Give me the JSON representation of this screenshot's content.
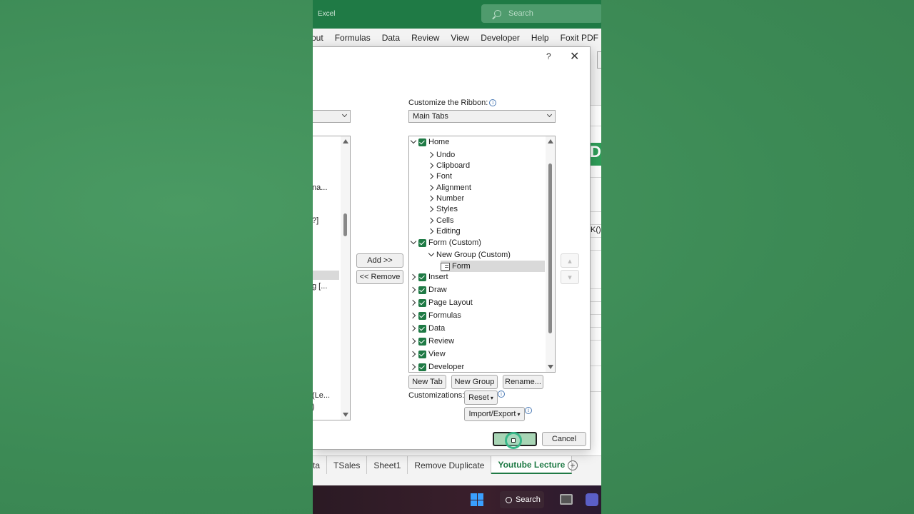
{
  "window": {
    "app_title": "Excel",
    "search_placeholder": "Search"
  },
  "ribbon": {
    "tabs": [
      "out",
      "Formulas",
      "Data",
      "Review",
      "View",
      "Developer",
      "Help",
      "Foxit PDF"
    ]
  },
  "sheet": {
    "green_cell_text": "D",
    "cell_text": "K()"
  },
  "dialog": {
    "help_label": "?",
    "close_label": "✕",
    "left_list_items": [
      "na...",
      "?]",
      "g [...",
      "(Le...",
      ")"
    ],
    "add_button": "Add >>",
    "remove_button": "<< Remove",
    "customize_label": "Customize the Ribbon:",
    "ribbon_combo_value": "Main Tabs",
    "tree": [
      {
        "label": "Home",
        "level": 0,
        "expanded": true,
        "checked": true
      },
      {
        "label": "Undo",
        "level": 1,
        "expanded": false
      },
      {
        "label": "Clipboard",
        "level": 1,
        "expanded": false
      },
      {
        "label": "Font",
        "level": 1,
        "expanded": false
      },
      {
        "label": "Alignment",
        "level": 1,
        "expanded": false
      },
      {
        "label": "Number",
        "level": 1,
        "expanded": false
      },
      {
        "label": "Styles",
        "level": 1,
        "expanded": false
      },
      {
        "label": "Cells",
        "level": 1,
        "expanded": false
      },
      {
        "label": "Editing",
        "level": 1,
        "expanded": false
      },
      {
        "label": "Form (Custom)",
        "level": 0,
        "expanded": true,
        "checked": true
      },
      {
        "label": "New Group (Custom)",
        "level": 1,
        "expanded": true
      },
      {
        "label": "Form",
        "level": 2,
        "selected": true
      },
      {
        "label": "Insert",
        "level": 0,
        "expanded": false,
        "checked": true
      },
      {
        "label": "Draw",
        "level": 0,
        "expanded": false,
        "checked": true
      },
      {
        "label": "Page Layout",
        "level": 0,
        "expanded": false,
        "checked": true
      },
      {
        "label": "Formulas",
        "level": 0,
        "expanded": false,
        "checked": true
      },
      {
        "label": "Data",
        "level": 0,
        "expanded": false,
        "checked": true
      },
      {
        "label": "Review",
        "level": 0,
        "expanded": false,
        "checked": true
      },
      {
        "label": "View",
        "level": 0,
        "expanded": false,
        "checked": true
      },
      {
        "label": "Developer",
        "level": 0,
        "expanded": false,
        "checked": true
      }
    ],
    "new_tab_button": "New Tab",
    "new_group_button": "New Group",
    "rename_button": "Rename...",
    "customizations_label": "Customizations:",
    "reset_button": "Reset",
    "import_export_button": "Import/Export",
    "ok_button": "",
    "cancel_button": "Cancel"
  },
  "sheet_tabs": [
    "ta",
    "TSales",
    "Sheet1",
    "Remove Duplicate",
    "Youtube Lecture"
  ],
  "active_sheet": "Youtube Lecture",
  "taskbar": {
    "search_label": "Search"
  },
  "colors": {
    "excel_green": "#1f7a45",
    "checkbox": "#1f7a45",
    "background": "#3f8f58"
  }
}
